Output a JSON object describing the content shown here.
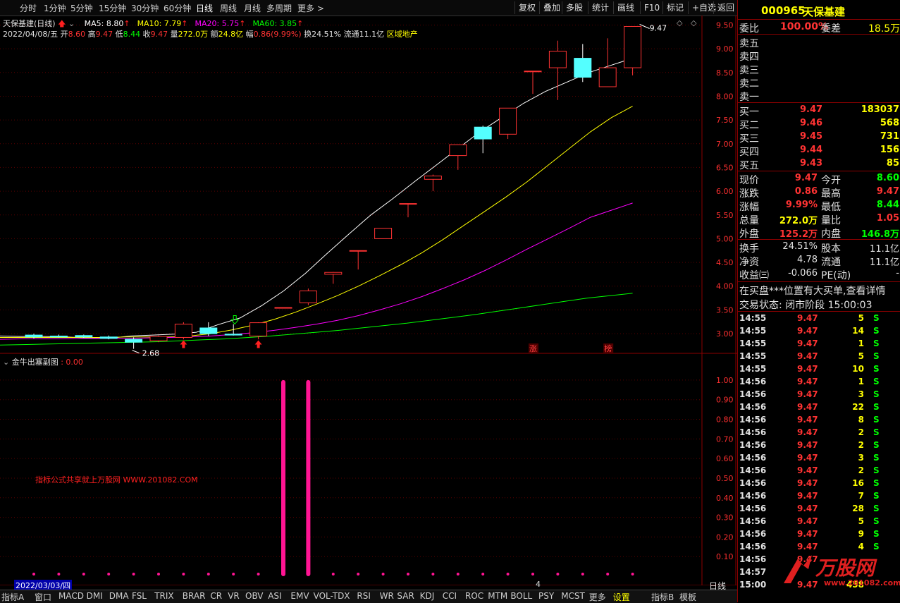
{
  "toolbar": {
    "periods": [
      "分时",
      "1分钟",
      "5分钟",
      "15分钟",
      "30分钟",
      "60分钟",
      "日线",
      "周线",
      "月线",
      "多周期",
      "更多"
    ],
    "active": "日线",
    "right_buttons": [
      "复权",
      "叠加",
      "多股",
      "统计",
      "画线",
      "F10",
      "标记",
      "+自选",
      "返回"
    ]
  },
  "main": {
    "title": "天保基建(日线)",
    "ma": [
      {
        "label": "MA5: 8.80",
        "color": "#ffffff"
      },
      {
        "label": "MA10: 7.79",
        "color": "#ffff00"
      },
      {
        "label": "MA20: 5.75",
        "color": "#ff00ff"
      },
      {
        "label": "MA60: 3.85",
        "color": "#00ff00"
      }
    ],
    "ohlc": {
      "date": "2022/04/08/五",
      "open_label": "开",
      "open": "8.60",
      "high_label": "高",
      "high": "9.47",
      "low_label": "低",
      "low": "8.44",
      "close_label": "收",
      "close": "9.47",
      "vol_label": "量",
      "vol": "272.0万",
      "amt_label": "额",
      "amt": "24.8亿",
      "chg_label": "幅",
      "chg": "0.86(9.99%)",
      "turn_label": "换",
      "turn": "24.51%",
      "float_label": "流通",
      "float": "11.1亿",
      "sector": "区域地产"
    },
    "price_axis": [
      "9.50",
      "9.00",
      "8.50",
      "8.00",
      "7.50",
      "7.00",
      "6.50",
      "6.00",
      "5.50",
      "5.00",
      "4.50",
      "4.00",
      "3.50",
      "3.00"
    ],
    "high_mark": "9.47",
    "low_mark": "2.68",
    "tags": [
      "涨",
      "榜"
    ]
  },
  "sub": {
    "title": "金牛出塞副图",
    "value": ": 0.00",
    "axis": [
      "1.00",
      "0.90",
      "0.80",
      "0.70",
      "0.60",
      "0.50",
      "0.40",
      "0.30",
      "0.20",
      "0.10"
    ],
    "watermark": "指标公式共享就上万股网 WWW.201082.COM"
  },
  "chart_data": [
    {
      "type": "candlestick",
      "title": "天保基建(日线)",
      "ylim": [
        2.6,
        9.7
      ],
      "x_start_label": "2022/03/03/四",
      "candles": [
        {
          "o": 2.97,
          "h": 3.0,
          "l": 2.9,
          "c": 2.93
        },
        {
          "o": 2.95,
          "h": 2.98,
          "l": 2.92,
          "c": 2.93
        },
        {
          "o": 2.96,
          "h": 2.98,
          "l": 2.91,
          "c": 2.93
        },
        {
          "o": 2.93,
          "h": 2.96,
          "l": 2.88,
          "c": 2.9
        },
        {
          "o": 2.88,
          "h": 2.92,
          "l": 2.68,
          "c": 2.82
        },
        {
          "o": 2.85,
          "h": 2.96,
          "l": 2.82,
          "c": 2.94
        },
        {
          "o": 2.92,
          "h": 3.24,
          "l": 2.88,
          "c": 3.2
        },
        {
          "o": 3.12,
          "h": 3.24,
          "l": 2.95,
          "c": 3.0
        },
        {
          "o": 2.99,
          "h": 3.2,
          "l": 2.96,
          "c": 2.97
        },
        {
          "o": 2.95,
          "h": 3.24,
          "l": 2.88,
          "c": 3.23
        },
        {
          "o": 3.55,
          "h": 3.55,
          "l": 3.55,
          "c": 3.55
        },
        {
          "o": 3.65,
          "h": 3.95,
          "l": 3.6,
          "c": 3.9
        },
        {
          "o": 4.25,
          "h": 4.3,
          "l": 4.05,
          "c": 4.29
        },
        {
          "o": 4.75,
          "h": 4.75,
          "l": 4.35,
          "c": 4.75
        },
        {
          "o": 5.0,
          "h": 5.22,
          "l": 5.0,
          "c": 5.22
        },
        {
          "o": 5.74,
          "h": 5.74,
          "l": 5.45,
          "c": 5.74
        },
        {
          "o": 6.25,
          "h": 6.35,
          "l": 6.0,
          "c": 6.32
        },
        {
          "o": 6.75,
          "h": 6.98,
          "l": 6.45,
          "c": 6.98
        },
        {
          "o": 7.35,
          "h": 7.38,
          "l": 6.8,
          "c": 7.1
        },
        {
          "o": 7.2,
          "h": 7.75,
          "l": 7.1,
          "c": 7.75
        },
        {
          "o": 8.53,
          "h": 8.53,
          "l": 8.05,
          "c": 8.53
        },
        {
          "o": 8.6,
          "h": 9.17,
          "l": 7.92,
          "c": 8.95
        },
        {
          "o": 8.8,
          "h": 9.1,
          "l": 8.3,
          "c": 8.4
        },
        {
          "o": 8.2,
          "h": 9.22,
          "l": 8.2,
          "c": 8.6
        },
        {
          "o": 8.6,
          "h": 9.47,
          "l": 8.44,
          "c": 9.47
        }
      ],
      "series": [
        {
          "name": "MA5",
          "color": "#ffffff",
          "values": [
            2.95,
            2.94,
            2.94,
            2.93,
            2.91,
            2.9,
            2.95,
            2.97,
            2.99,
            3.03,
            3.19,
            3.33,
            3.59,
            3.9,
            4.27,
            4.69,
            5.1,
            5.5,
            5.84,
            6.2,
            6.55,
            6.9,
            7.25,
            7.55,
            7.85,
            8.1,
            8.3,
            8.5,
            8.65,
            8.8
          ]
        },
        {
          "name": "MA10",
          "color": "#ffff00",
          "values": [
            2.92,
            2.92,
            2.92,
            2.92,
            2.92,
            2.92,
            2.93,
            2.93,
            2.93,
            2.95,
            3.0,
            3.08,
            3.18,
            3.3,
            3.45,
            3.62,
            3.8,
            4.0,
            4.22,
            4.45,
            4.7,
            4.98,
            5.28,
            5.58,
            5.88,
            6.2,
            6.55,
            6.9,
            7.25,
            7.55,
            7.79
          ]
        },
        {
          "name": "MA20",
          "color": "#ff00ff",
          "values": [
            2.88,
            2.89,
            2.89,
            2.89,
            2.9,
            2.9,
            2.9,
            2.91,
            2.92,
            2.93,
            2.95,
            2.98,
            3.02,
            3.07,
            3.13,
            3.2,
            3.28,
            3.38,
            3.5,
            3.63,
            3.78,
            3.95,
            4.13,
            4.33,
            4.55,
            4.78,
            5.0,
            5.22,
            5.45,
            5.6,
            5.75
          ]
        },
        {
          "name": "MA60",
          "color": "#00ff00",
          "values": [
            2.76,
            2.77,
            2.78,
            2.79,
            2.8,
            2.81,
            2.82,
            2.83,
            2.85,
            2.87,
            2.89,
            2.92,
            2.95,
            2.99,
            3.03,
            3.07,
            3.12,
            3.17,
            3.22,
            3.28,
            3.34,
            3.4,
            3.47,
            3.54,
            3.61,
            3.68,
            3.75,
            3.8,
            3.85
          ]
        }
      ]
    },
    {
      "type": "bar",
      "title": "金牛出塞副图",
      "ylim": [
        0,
        1.05
      ],
      "values": [
        0,
        0,
        0,
        0,
        0,
        0,
        0,
        0,
        0,
        0,
        1,
        1,
        0,
        0,
        0,
        0,
        0,
        0,
        0,
        0,
        0,
        0,
        0,
        0,
        0
      ]
    }
  ],
  "quote": {
    "code": "000965",
    "name": "天保基建",
    "wb_label": "委比",
    "wb": "100.00%",
    "wc_label": "委差",
    "wc": "18.5万",
    "sells": [
      {
        "label": "卖五",
        "price": "",
        "vol": ""
      },
      {
        "label": "卖四",
        "price": "",
        "vol": ""
      },
      {
        "label": "卖三",
        "price": "",
        "vol": ""
      },
      {
        "label": "卖二",
        "price": "",
        "vol": ""
      },
      {
        "label": "卖一",
        "price": "",
        "vol": ""
      }
    ],
    "buys": [
      {
        "label": "买一",
        "price": "9.47",
        "vol": "183037"
      },
      {
        "label": "买二",
        "price": "9.46",
        "vol": "568"
      },
      {
        "label": "买三",
        "price": "9.45",
        "vol": "731"
      },
      {
        "label": "买四",
        "price": "9.44",
        "vol": "156"
      },
      {
        "label": "买五",
        "price": "9.43",
        "vol": "85"
      }
    ],
    "stats": [
      {
        "l1": "现价",
        "v1": "9.47",
        "c1": "#ff3333",
        "l2": "今开",
        "v2": "8.60",
        "c2": "#00ff00"
      },
      {
        "l1": "涨跌",
        "v1": "0.86",
        "c1": "#ff3333",
        "l2": "最高",
        "v2": "9.47",
        "c2": "#ff3333"
      },
      {
        "l1": "涨幅",
        "v1": "9.99%",
        "c1": "#ff3333",
        "l2": "最低",
        "v2": "8.44",
        "c2": "#00ff00"
      },
      {
        "l1": "总量",
        "v1": "272.0万",
        "c1": "#ffff00",
        "l2": "量比",
        "v2": "1.05",
        "c2": "#ff3333"
      },
      {
        "l1": "外盘",
        "v1": "125.2万",
        "c1": "#ff3333",
        "l2": "内盘",
        "v2": "146.8万",
        "c2": "#00ff00"
      }
    ],
    "stats2": [
      {
        "l1": "换手",
        "v1": "24.51%",
        "l2": "股本",
        "v2": "11.1亿"
      },
      {
        "l1": "净资",
        "v1": "4.78",
        "l2": "流通",
        "v2": "11.1亿"
      },
      {
        "l1": "收益㈢",
        "v1": "-0.066",
        "l2": "PE(动)",
        "v2": "-"
      }
    ],
    "notice": "在买盘***位置有大买单,查看详情",
    "status": "交易状态: 闭市阶段 15:00:03",
    "ticks": [
      {
        "t": "14:55",
        "p": "9.47",
        "v": "5",
        "s": "S"
      },
      {
        "t": "14:55",
        "p": "9.47",
        "v": "14",
        "s": "S"
      },
      {
        "t": "14:55",
        "p": "9.47",
        "v": "1",
        "s": "S"
      },
      {
        "t": "14:55",
        "p": "9.47",
        "v": "5",
        "s": "S"
      },
      {
        "t": "14:55",
        "p": "9.47",
        "v": "10",
        "s": "S"
      },
      {
        "t": "14:56",
        "p": "9.47",
        "v": "1",
        "s": "S"
      },
      {
        "t": "14:56",
        "p": "9.47",
        "v": "3",
        "s": "S"
      },
      {
        "t": "14:56",
        "p": "9.47",
        "v": "22",
        "s": "S"
      },
      {
        "t": "14:56",
        "p": "9.47",
        "v": "8",
        "s": "S"
      },
      {
        "t": "14:56",
        "p": "9.47",
        "v": "2",
        "s": "S"
      },
      {
        "t": "14:56",
        "p": "9.47",
        "v": "2",
        "s": "S"
      },
      {
        "t": "14:56",
        "p": "9.47",
        "v": "3",
        "s": "S"
      },
      {
        "t": "14:56",
        "p": "9.47",
        "v": "2",
        "s": "S"
      },
      {
        "t": "14:56",
        "p": "9.47",
        "v": "16",
        "s": "S"
      },
      {
        "t": "14:56",
        "p": "9.47",
        "v": "7",
        "s": "S"
      },
      {
        "t": "14:56",
        "p": "9.47",
        "v": "28",
        "s": "S"
      },
      {
        "t": "14:56",
        "p": "9.47",
        "v": "5",
        "s": "S"
      },
      {
        "t": "14:56",
        "p": "9.47",
        "v": "9",
        "s": "S"
      },
      {
        "t": "14:56",
        "p": "9.47",
        "v": "4",
        "s": "S"
      },
      {
        "t": "14:56",
        "p": "9.47",
        "v": "",
        "s": ""
      },
      {
        "t": "14:57",
        "p": "",
        "v": "",
        "s": ""
      },
      {
        "t": "15:00",
        "p": "9.47",
        "v": "458",
        "s": ""
      }
    ],
    "logo": "万股网",
    "logo_url": "www.201082.com"
  },
  "bottom": {
    "date": "2022/03/03/四",
    "cursor_num": "4",
    "period_label": "日线",
    "tabs": [
      "指标A",
      "窗口",
      "MACD",
      "DMI",
      "DMA",
      "FSL",
      "TRIX",
      "BRAR",
      "CR",
      "VR",
      "OBV",
      "ASI",
      "EMV",
      "VOL-TDX",
      "RSI",
      "WR",
      "SAR",
      "KDJ",
      "CCI",
      "ROC",
      "MTM",
      "BOLL",
      "PSY",
      "MCST",
      "更多",
      "设置"
    ],
    "right_tabs": [
      "指标B",
      "模板"
    ],
    "active_tab": "设置"
  },
  "colors": {
    "up": "#ff3333",
    "down": "#54ffff",
    "border": "#8b0000",
    "grid": "#5a0000"
  }
}
